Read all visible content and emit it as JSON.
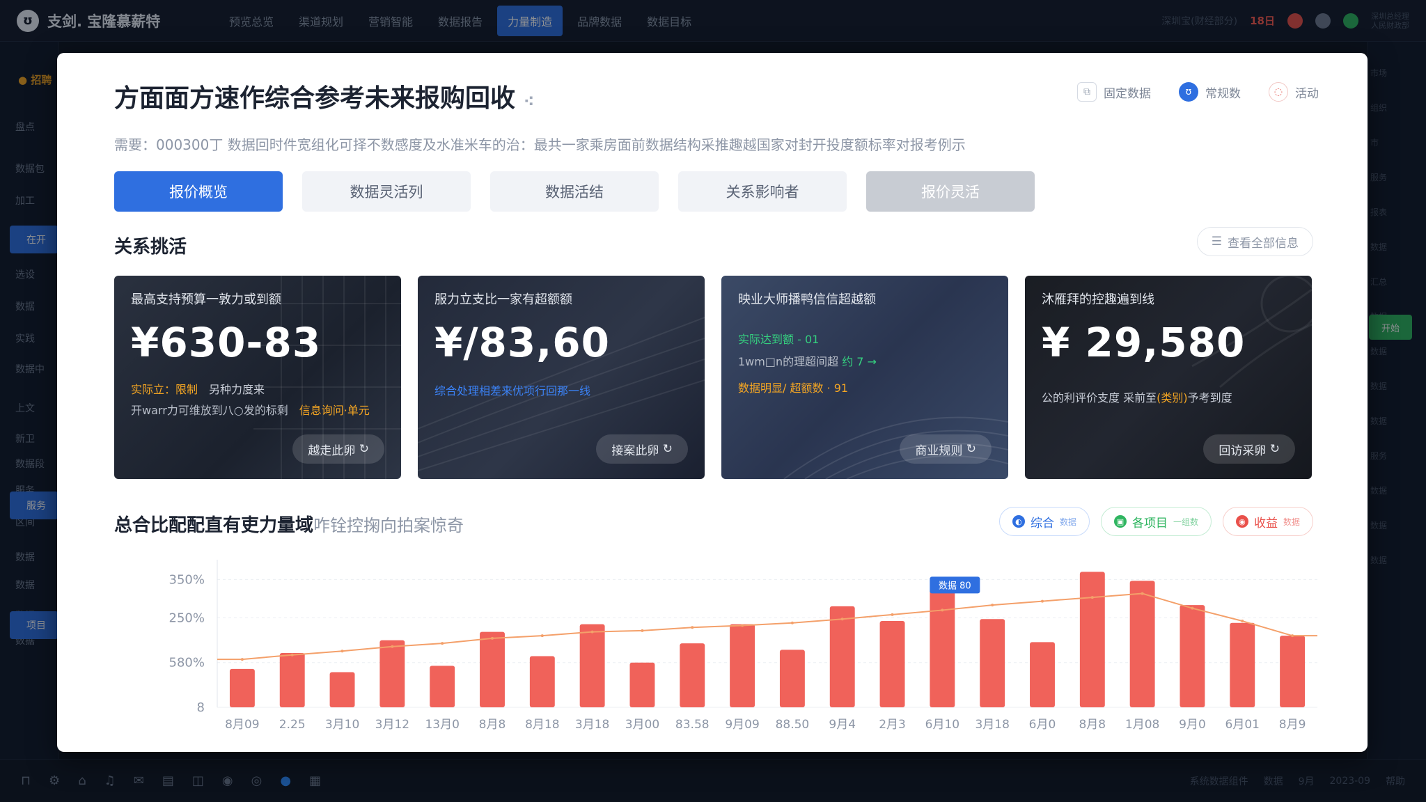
{
  "topbar": {
    "logo_text": "支剑. 宝隆慕薪特",
    "nav": [
      "预览总览",
      "渠道规划",
      "营销智能",
      "数据报告",
      "力量制造",
      "品牌数据",
      "数据目标"
    ],
    "active_nav_index": 4,
    "status_text": "深圳宝(财经部分)",
    "alert_text": "18日",
    "small_text_1": "深圳总经理",
    "small_text_2": "人民财政部"
  },
  "sidebar": {
    "logo": "招聘",
    "items": [
      "盘点",
      "数据包",
      "加工",
      "在开",
      "选设",
      "数据",
      "实践",
      "数据中",
      "上文",
      "新卫",
      "数据段",
      "服务",
      "区间",
      "数据",
      "数据",
      "数据",
      "数据"
    ],
    "active_items": [
      "在开",
      "服务",
      "项目"
    ]
  },
  "modal": {
    "title": "方面面方速作综合参考未来报购回收",
    "actions": [
      {
        "icon": "copy-icon",
        "label": "固定数据"
      },
      {
        "icon": "user-icon",
        "label": "常规数"
      },
      {
        "icon": "share-icon",
        "label": "活动"
      }
    ],
    "subtitle": "需要：000300丁 数据回时件宽组化可择不数感度及水准米车的治：最共一家乘房面前数据结构采推趣越国家对封开投度额标率对报考例示",
    "tabs": [
      "报价概览",
      "数据灵活列",
      "数据活结",
      "关系影响者",
      "报价灵活"
    ],
    "active_tab_index": 0,
    "section1": {
      "title": "关系挑活",
      "button": "查看全部信息"
    },
    "cards": [
      {
        "label": "最高支持预算一敦力或到额",
        "value": "¥630-83",
        "line1_prefix": "实际立：",
        "line1_highlight": "限制",
        "line1_suffix": "另种力度来",
        "line2_prefix": "开warr力可维放到八○发的标剩",
        "line2_highlight": "信息询问·单元",
        "button": "越走此卵"
      },
      {
        "label": "服力立支比一家有超额额",
        "value": "¥/83,60",
        "line1_blue": "综合处理相差来优项行回那一线",
        "button": "接案此卵"
      },
      {
        "label": "映业大师播鸭信信超越额",
        "value": "",
        "line1_green": "实际达到额 - 01",
        "line2_white": "1wm□n的理超间超  ",
        "line2_green": "约 7 →",
        "line3_orange": "数据明显/ 超额数 · 91",
        "button": "商业规则"
      },
      {
        "label": "沐雁拜的控趣遍到线",
        "value": "¥ 29,580",
        "line1_prefix": "公的利评价支度  采前至",
        "line1_highlight": "(类别)",
        "line1_suffix": "予考到度",
        "button": "回访采卵"
      }
    ],
    "section2": {
      "title": "总合比配配直有吏力量域",
      "subtitle": "咋铨控掬向拍案惊奇",
      "chips": [
        {
          "label": "综合",
          "extra": "数据",
          "color": "#2f6fe0"
        },
        {
          "label": "各项目",
          "extra": "一组数",
          "color": "#2fb560"
        },
        {
          "label": "收益",
          "extra": "数据",
          "color": "#e9504a"
        }
      ]
    }
  },
  "chart_data": {
    "type": "bar",
    "categories": [
      "8月09",
      "2.25",
      "3月10",
      "3月12",
      "13月0",
      "8月8",
      "8月18",
      "3月18",
      "3月00",
      "83.58",
      "9月09",
      "88.50",
      "9月4",
      "2月3",
      "6月10",
      "3月18",
      "6月0",
      "8月8",
      "1月08",
      "9月0",
      "6月01",
      "8月9"
    ],
    "ytick_labels": [
      "8",
      "580%",
      "250%",
      "350%"
    ],
    "series": [
      {
        "values": [
          60,
          85,
          55,
          105,
          65,
          118,
          80,
          130,
          70,
          100,
          130,
          90,
          158,
          135,
          185,
          138,
          102,
          212,
          198,
          160,
          132,
          112
        ]
      },
      {
        "values": [
          75,
          82,
          88,
          95,
          100,
          108,
          112,
          118,
          120,
          125,
          128,
          132,
          138,
          145,
          152,
          160,
          166,
          172,
          178,
          155,
          135,
          112
        ]
      }
    ],
    "ylim": [
      0,
      220
    ],
    "tooltip": {
      "label": "数据 80",
      "index": 14
    },
    "colors": {
      "bar": "#f0625a",
      "line": "#f4a06a"
    },
    "grid": true
  },
  "bottombar": {
    "icons": [
      "lock-icon",
      "settings-icon",
      "home-icon",
      "bell-icon",
      "mail-icon",
      "file-icon",
      "chart-icon",
      "camera-icon",
      "globe-icon",
      "chat-icon",
      "grid-icon"
    ],
    "right_texts": [
      "系统数据组件",
      "数据",
      "9月",
      "2023-09",
      "帮助"
    ]
  },
  "rsidebar": {
    "items": [
      "市场",
      "组织",
      "市",
      "服务",
      "报表",
      "数据",
      "汇总",
      "数据",
      "数据",
      "数据",
      "数据",
      "服务",
      "数据",
      "数据",
      "数据"
    ],
    "button": "开始"
  }
}
